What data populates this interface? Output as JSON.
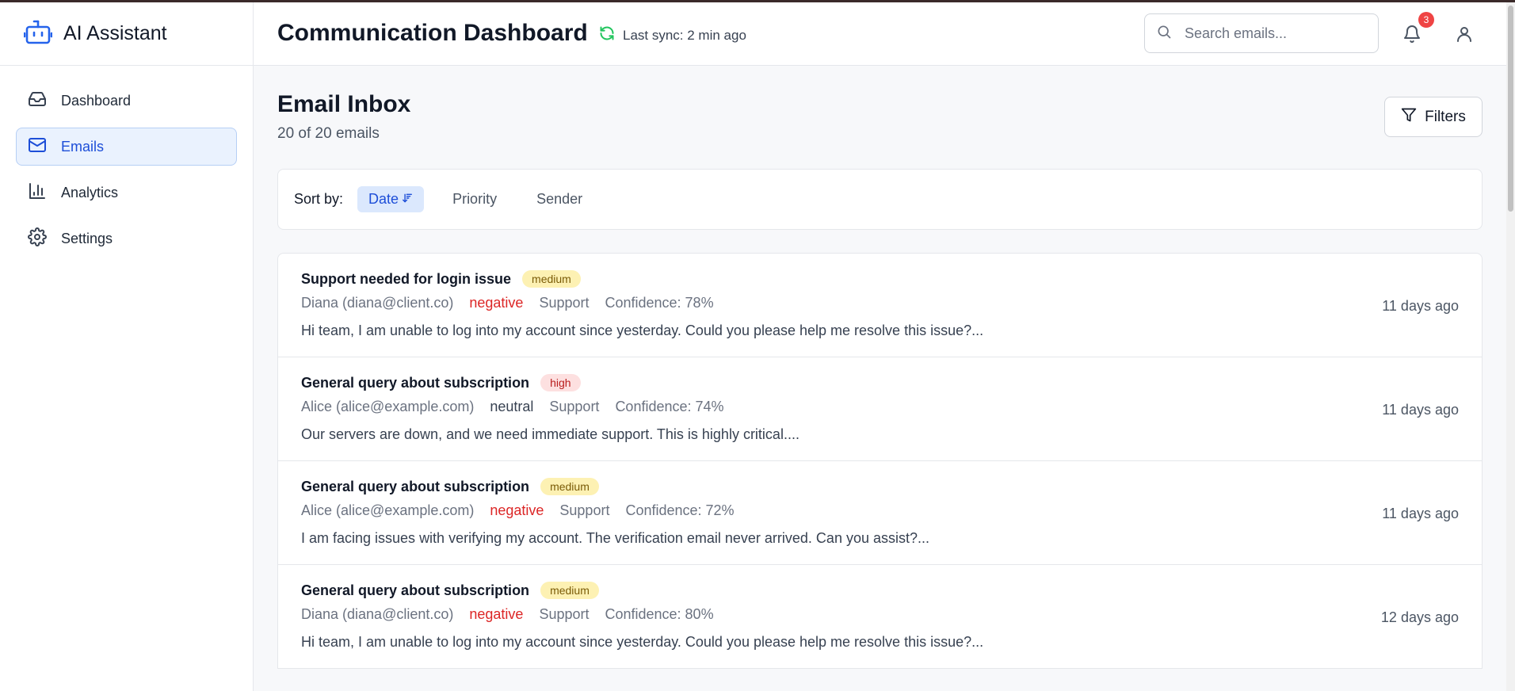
{
  "app": {
    "name": "AI Assistant"
  },
  "sidebar": {
    "items": [
      {
        "label": "Dashboard",
        "icon": "inbox-icon",
        "active": false
      },
      {
        "label": "Emails",
        "icon": "mail-icon",
        "active": true
      },
      {
        "label": "Analytics",
        "icon": "bar-chart-icon",
        "active": false
      },
      {
        "label": "Settings",
        "icon": "gear-icon",
        "active": false
      }
    ]
  },
  "header": {
    "title": "Communication Dashboard",
    "sync_text": "Last sync: 2 min ago",
    "search_placeholder": "Search emails...",
    "notification_count": "3"
  },
  "inbox": {
    "title": "Email Inbox",
    "count_text": "20 of 20 emails",
    "filters_label": "Filters",
    "sort_label": "Sort by:",
    "sort_options": [
      {
        "label": "Date",
        "active": true
      },
      {
        "label": "Priority",
        "active": false
      },
      {
        "label": "Sender",
        "active": false
      }
    ],
    "emails": [
      {
        "subject": "Support needed for login issue",
        "priority": "medium",
        "sender": "Diana (diana@client.co)",
        "sentiment": "negative",
        "category": "Support",
        "confidence": "Confidence: 78%",
        "preview": "Hi team, I am unable to log into my account since yesterday. Could you please help me resolve this issue?...",
        "time": "11 days ago"
      },
      {
        "subject": "General query about subscription",
        "priority": "high",
        "sender": "Alice (alice@example.com)",
        "sentiment": "neutral",
        "category": "Support",
        "confidence": "Confidence: 74%",
        "preview": "Our servers are down, and we need immediate support. This is highly critical....",
        "time": "11 days ago"
      },
      {
        "subject": "General query about subscription",
        "priority": "medium",
        "sender": "Alice (alice@example.com)",
        "sentiment": "negative",
        "category": "Support",
        "confidence": "Confidence: 72%",
        "preview": "I am facing issues with verifying my account. The verification email never arrived. Can you assist?...",
        "time": "11 days ago"
      },
      {
        "subject": "General query about subscription",
        "priority": "medium",
        "sender": "Diana (diana@client.co)",
        "sentiment": "negative",
        "category": "Support",
        "confidence": "Confidence: 80%",
        "preview": "Hi team, I am unable to log into my account since yesterday. Could you please help me resolve this issue?...",
        "time": "12 days ago"
      }
    ]
  },
  "colors": {
    "accent": "#1d4ed8",
    "negative": "#dc2626",
    "sync_green": "#22c55e",
    "badge_red": "#ef4444"
  }
}
